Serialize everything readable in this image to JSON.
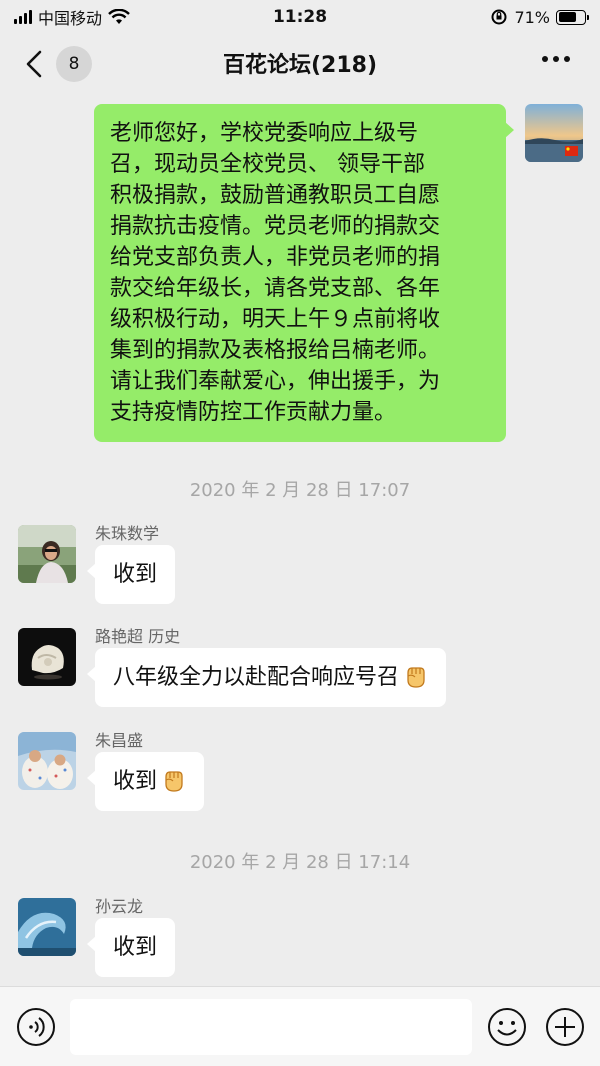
{
  "status_bar": {
    "carrier": "中国移动",
    "time": "11:28",
    "battery_percent": "71%",
    "battery_level": 0.71,
    "icons": [
      "signal-icon",
      "wifi-icon",
      "orientation-lock-icon",
      "battery-icon"
    ]
  },
  "nav": {
    "unread_count": "8",
    "title": "百花论坛(218)",
    "icons": [
      "back-chevron-icon",
      "more-icon"
    ]
  },
  "messages": [
    {
      "side": "me",
      "lines": [
        "老师您好，学校党委响应上级号",
        "召，现动员全校党员、 领导干部",
        "积极捐款，鼓励普通教职员工自愿",
        "捐款抗击疫情。党员老师的捐款交",
        "给党支部负责人，非党员老师的捐",
        "款交给年级长，请各党支部、各年",
        "级积极行动，明天上午９点前将收",
        "集到的捐款及表格报给吕楠老师。",
        "请让我们奉献爱心，伸出援手，为",
        "支持疫情防控工作贡献力量。"
      ]
    },
    {
      "timestamp": "2020 年 2 月 28 日 17:07"
    },
    {
      "side": "them",
      "sender": "朱珠数学",
      "text": "收到",
      "emoji": ""
    },
    {
      "side": "them",
      "sender": "路艳超 历史",
      "text": "八年级全力以赴配合响应号召",
      "emoji": "fist-emoji"
    },
    {
      "side": "them",
      "sender": "朱昌盛",
      "text": "收到",
      "emoji": "fist-emoji"
    },
    {
      "timestamp": "2020 年 2 月 28 日 17:14"
    },
    {
      "side": "them",
      "sender": "孙云龙",
      "text": "收到",
      "emoji": ""
    }
  ],
  "input_bar": {
    "input_value": "",
    "icons": [
      "voice-icon",
      "emoji-icon",
      "plus-icon"
    ]
  },
  "colors": {
    "background": "#ededed",
    "my_bubble": "#95ec69",
    "their_bubble": "#ffffff",
    "timestamp_text": "#a6a6a6"
  }
}
